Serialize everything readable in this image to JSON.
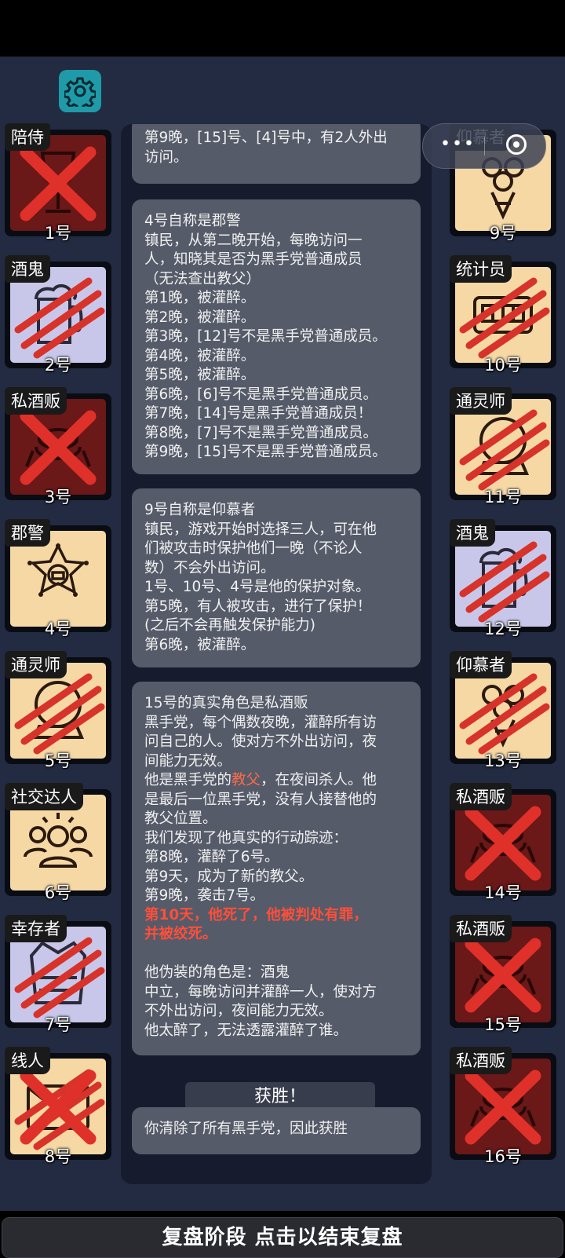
{
  "players": [
    {
      "id": "p1",
      "role": "陪侍",
      "num": "1号"
    },
    {
      "id": "p2",
      "role": "酒鬼",
      "num": "2号"
    },
    {
      "id": "p3",
      "role": "私酒贩",
      "num": "3号"
    },
    {
      "id": "p4",
      "role": "郡警",
      "num": "4号"
    },
    {
      "id": "p5",
      "role": "通灵师",
      "num": "5号"
    },
    {
      "id": "p6",
      "role": "社交达人",
      "num": "6号"
    },
    {
      "id": "p7",
      "role": "幸存者",
      "num": "7号"
    },
    {
      "id": "p8",
      "role": "线人",
      "num": "8号"
    },
    {
      "id": "p9",
      "role": "仰慕者",
      "num": "9号"
    },
    {
      "id": "p10",
      "role": "统计员",
      "num": "10号"
    },
    {
      "id": "p11",
      "role": "通灵师",
      "num": "11号"
    },
    {
      "id": "p12",
      "role": "酒鬼",
      "num": "12号"
    },
    {
      "id": "p13",
      "role": "仰慕者",
      "num": "13号"
    },
    {
      "id": "p14",
      "role": "私酒贩",
      "num": "14号"
    },
    {
      "id": "p15",
      "role": "私酒贩",
      "num": "15号"
    },
    {
      "id": "p16",
      "role": "私酒贩",
      "num": "16号"
    }
  ],
  "log": {
    "block0": [
      "第9晚，[15]号、[4]号中，有2人外出",
      "访问。"
    ],
    "block1": [
      "4号自称是郡警",
      "镇民，从第二晚开始，每晚访问一",
      "人，知晓其是否为黑手党普通成员",
      "（无法查出教父）",
      "第1晚，被灌醉。",
      "第2晚，被灌醉。",
      "第3晚，[12]号不是黑手党普通成员。",
      "第4晚，被灌醉。",
      "第5晚，被灌醉。",
      "第6晚，[6]号不是黑手党普通成员。",
      "第7晚，[14]号是黑手党普通成员！",
      "第8晚，[7]号不是黑手党普通成员。",
      "第9晚，[15]号不是黑手党普通成员。"
    ],
    "block2": [
      "9号自称是仰慕者",
      "镇民，游戏开始时选择三人，可在他",
      "们被攻击时保护他们一晚（不论人",
      "数）不会外出访问。",
      "1号、10号、4号是他的保护对象。",
      "第5晚，有人被攻击，进行了保护！",
      "(之后不会再触发保护能力)",
      "第6晚，被灌醉。"
    ],
    "block3": {
      "l1": "15号的真实角色是私酒贩",
      "l2": "黑手党，每个偶数夜晚，灌醉所有访",
      "l3": "问自己的人。使对方不外出访问，夜",
      "l4": "间能力无效。",
      "l5a": "他是黑手党的",
      "l5b": "教父",
      "l5c": "，在夜间杀人。他",
      "l6": "是最后一位黑手党，没有人接替他的",
      "l7": "教父位置。",
      "l8": "我们发现了他真实的行动踪迹：",
      "l9": "第8晚，灌醉了6号。",
      "l10": "第9天，成为了新的教父。",
      "l11": "第9晚，袭击7号。",
      "l12": "第10天，他死了，他被判处有罪，",
      "l13": "并被绞死。",
      "l14": "他伪装的角色是：酒鬼",
      "l15": "中立，每晚访问并灌醉一人，使对方",
      "l16": "不外出访问，夜间能力无效。",
      "l17": "他太醉了，无法透露灌醉了谁。"
    },
    "win_label": "获胜！",
    "result": "你清除了所有黑手党，因此获胜"
  },
  "footer": {
    "end_review": "复盘阶段 点击以结束复盘"
  },
  "colors": {
    "stage": "#232b42",
    "card_beige": "#f6d8a4",
    "card_lavender": "#c8c7ea",
    "card_dead": "#6a1818",
    "scratch": "#d7332a",
    "highlight": "#ff4e3a"
  },
  "icons": {
    "settings": "gear-icon",
    "capsule_more": "more-dots-icon",
    "capsule_close": "target-circle-icon"
  }
}
